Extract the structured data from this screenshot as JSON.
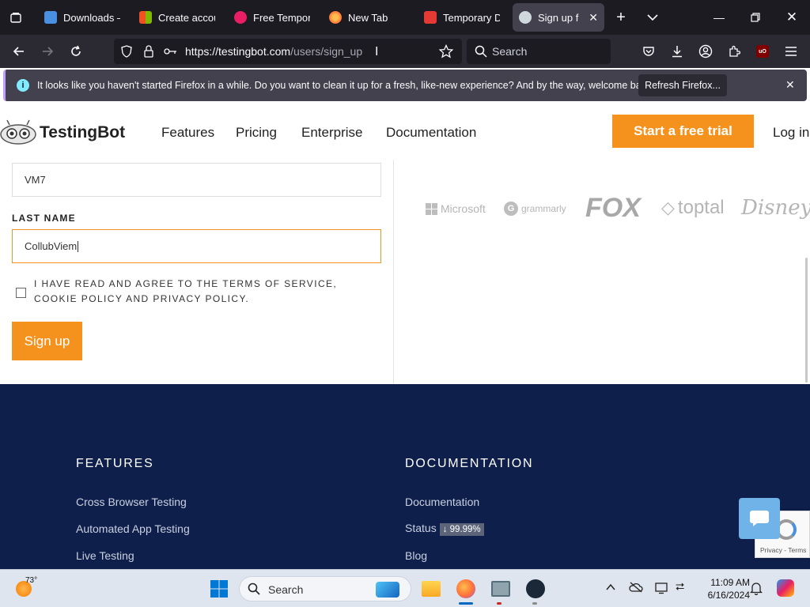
{
  "browser": {
    "tabs": [
      {
        "label": "Downloads – ",
        "icon": "downloads-icon",
        "color": "#4a90e2"
      },
      {
        "label": "Create accoun",
        "icon": "microsoft-icon",
        "color": "#f25022"
      },
      {
        "label": "Free Tempora",
        "icon": "tempmail-icon",
        "color": "#e91e63"
      },
      {
        "label": "New Tab",
        "icon": "firefox-icon",
        "color": "#ff7139"
      },
      {
        "label": "Temporary Dir",
        "icon": "mail-icon",
        "color": "#e53935"
      },
      {
        "label": "Sign up for",
        "icon": "testingbot-icon",
        "color": "#cfd8dc"
      }
    ],
    "url_host": "https://testingbot.com",
    "url_path": "/users/sign_up",
    "search_placeholder": "Search",
    "notification": {
      "text": "It looks like you haven't started Firefox in a while. Do you want to clean it up for a fresh, like-new experience? And by the way, welcome back!",
      "button": "Refresh Firefox..."
    }
  },
  "site": {
    "logo": "TestingBot",
    "nav": [
      "Features",
      "Pricing",
      "Enterprise",
      "Documentation"
    ],
    "cta": "Start a free trial",
    "login": "Log in"
  },
  "form": {
    "first_name_value": "VM7",
    "last_name_label": "LAST NAME",
    "last_name_value": "CollubViem",
    "terms_text": "I HAVE READ AND AGREE TO THE TERMS OF SERVICE, COOKIE POLICY AND PRIVACY POLICY.",
    "submit": "Sign up"
  },
  "brands": [
    "Microsoft",
    "grammarly",
    "FOX",
    "toptal",
    "Disney"
  ],
  "footer": {
    "features_heading": "FEATURES",
    "features_links": [
      "Cross Browser Testing",
      "Automated App Testing",
      "Live Testing"
    ],
    "docs_heading": "DOCUMENTATION",
    "docs_links": [
      "Documentation",
      "Status",
      "Blog"
    ],
    "status_badge": "↓ 99.99%",
    "recaptcha_text": "Privacy - Terms"
  },
  "taskbar": {
    "weather": "73°",
    "search_placeholder": "Search",
    "time": "11:09 AM",
    "date": "6/16/2024"
  }
}
